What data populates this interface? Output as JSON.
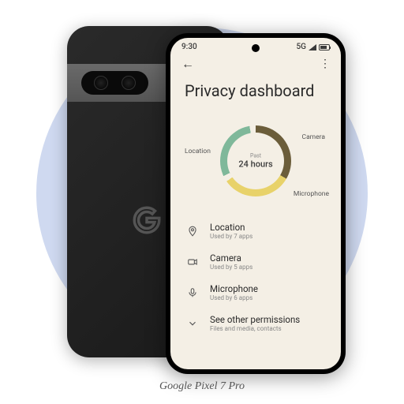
{
  "caption": "Google Pixel 7 Pro",
  "status": {
    "time": "9:30",
    "network": "5G"
  },
  "header": {
    "title": "Privacy dashboard"
  },
  "chart_data": {
    "type": "pie",
    "title": "Past 24 hours",
    "series": [
      {
        "name": "Camera",
        "value": 33
      },
      {
        "name": "Microphone",
        "value": 32
      },
      {
        "name": "Location",
        "value": 30
      }
    ],
    "labels": {
      "location": "Location",
      "camera": "Camera",
      "microphone": "Microphone"
    },
    "center": {
      "small": "Past",
      "big": "24 hours"
    }
  },
  "list": {
    "items": [
      {
        "label": "Location",
        "sub": "Used by 7 apps"
      },
      {
        "label": "Camera",
        "sub": "Used by 5 apps"
      },
      {
        "label": "Microphone",
        "sub": "Used by 6 apps"
      },
      {
        "label": "See other permissions",
        "sub": "Files and media, contacts"
      }
    ]
  },
  "icons": {
    "location": "location-pin-icon",
    "camera": "camera-icon",
    "microphone": "microphone-icon",
    "expand": "chevron-down-icon",
    "back": "arrow-back-icon",
    "more": "more-vert-icon"
  }
}
